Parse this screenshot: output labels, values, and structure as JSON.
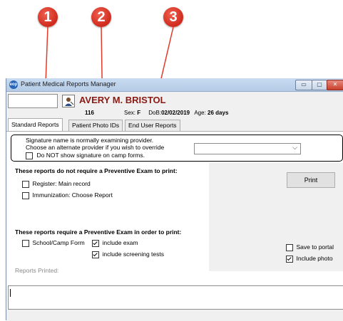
{
  "callouts": [
    "1",
    "2",
    "3"
  ],
  "window": {
    "title": "Patient Medical Reports Manager",
    "app_icon_text": "eop",
    "controls": {
      "minimize": "▭",
      "maximize": "▢",
      "close": "✕"
    }
  },
  "patient": {
    "name": "AVERY M. BRISTOL",
    "id": "116",
    "sex_label": "Sex:",
    "sex": "F",
    "dob_label": "DoB:",
    "dob": "02/02/2019",
    "age_label": "Age:",
    "age": "26 days"
  },
  "tabs": [
    "Standard Reports",
    "Patient Photo IDs",
    "End User Reports"
  ],
  "signature": {
    "line1": "Signature name is normally examining provider.",
    "line2": "Choose an alternate provider if you wish to override",
    "do_not_show_label": "Do NOT show signature on camp forms.",
    "provider_value": ""
  },
  "no_exam_section": {
    "header": "These reports do not require a Preventive Exam to print:",
    "items": [
      "Register: Main record",
      "Immunization: Choose Report"
    ]
  },
  "exam_section": {
    "header": "These reports require a Preventive Exam in order to print:",
    "school_camp_label": "School/Camp Form",
    "include_exam_label": "include exam",
    "include_screening_label": "include screening tests"
  },
  "print_button": "Print",
  "save_to_portal_label": "Save to portal",
  "include_photo_label": "Include photo",
  "reports_printed_label": "Reports Printed:",
  "reports_printed_value": ""
}
